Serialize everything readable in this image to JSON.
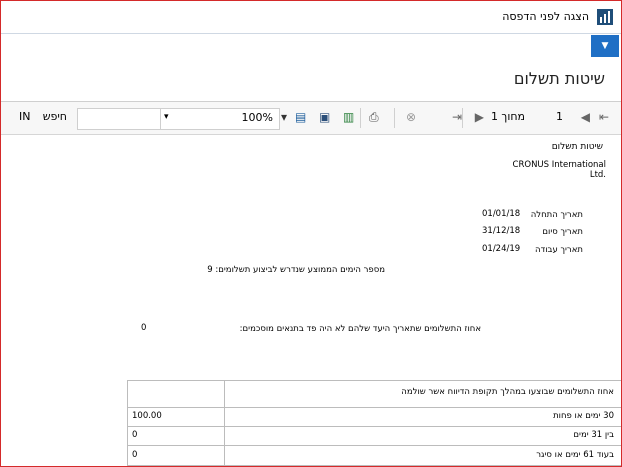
{
  "window": {
    "title": "הצגה לפני הדפסה",
    "dropdown_icon": "chevron-down-icon"
  },
  "page": {
    "title": "שיטות תשלום"
  },
  "toolbar": {
    "page_input": "1",
    "page_label": "מחוך 1",
    "zoom_value": "100%",
    "search_label": "חיפש",
    "next_label": "IN"
  },
  "report": {
    "title": "שיטות תשלום",
    "company": "CRONUS International Ltd.",
    "dates": [
      {
        "label": "תאריך התחלה",
        "value": "01/01/18"
      },
      {
        "label": "תאריך סיום",
        "value": "31/12/18"
      },
      {
        "label": "תאריך עבודה",
        "value": "01/24/19"
      }
    ],
    "avg_days_text": "מספר הימים הממוצע שנדרש לביצוע תשלומים: 9",
    "pct_late_text": "אחוז התשלומים שתאריך היעד שלהם לא היה פד בתנאים מוסכמים:",
    "pct_late_value": "0",
    "table": {
      "header": "אחוז התשלומים שבוצעו במהלך תקופת הדיווח אשר שולמה",
      "rows": [
        {
          "label": "30 ימים או פחות",
          "value": "100.00"
        },
        {
          "label": "בין 31 ימים",
          "value": "0"
        },
        {
          "label": "בעוד 61 ימים או סיגר",
          "value": "0"
        }
      ]
    }
  }
}
